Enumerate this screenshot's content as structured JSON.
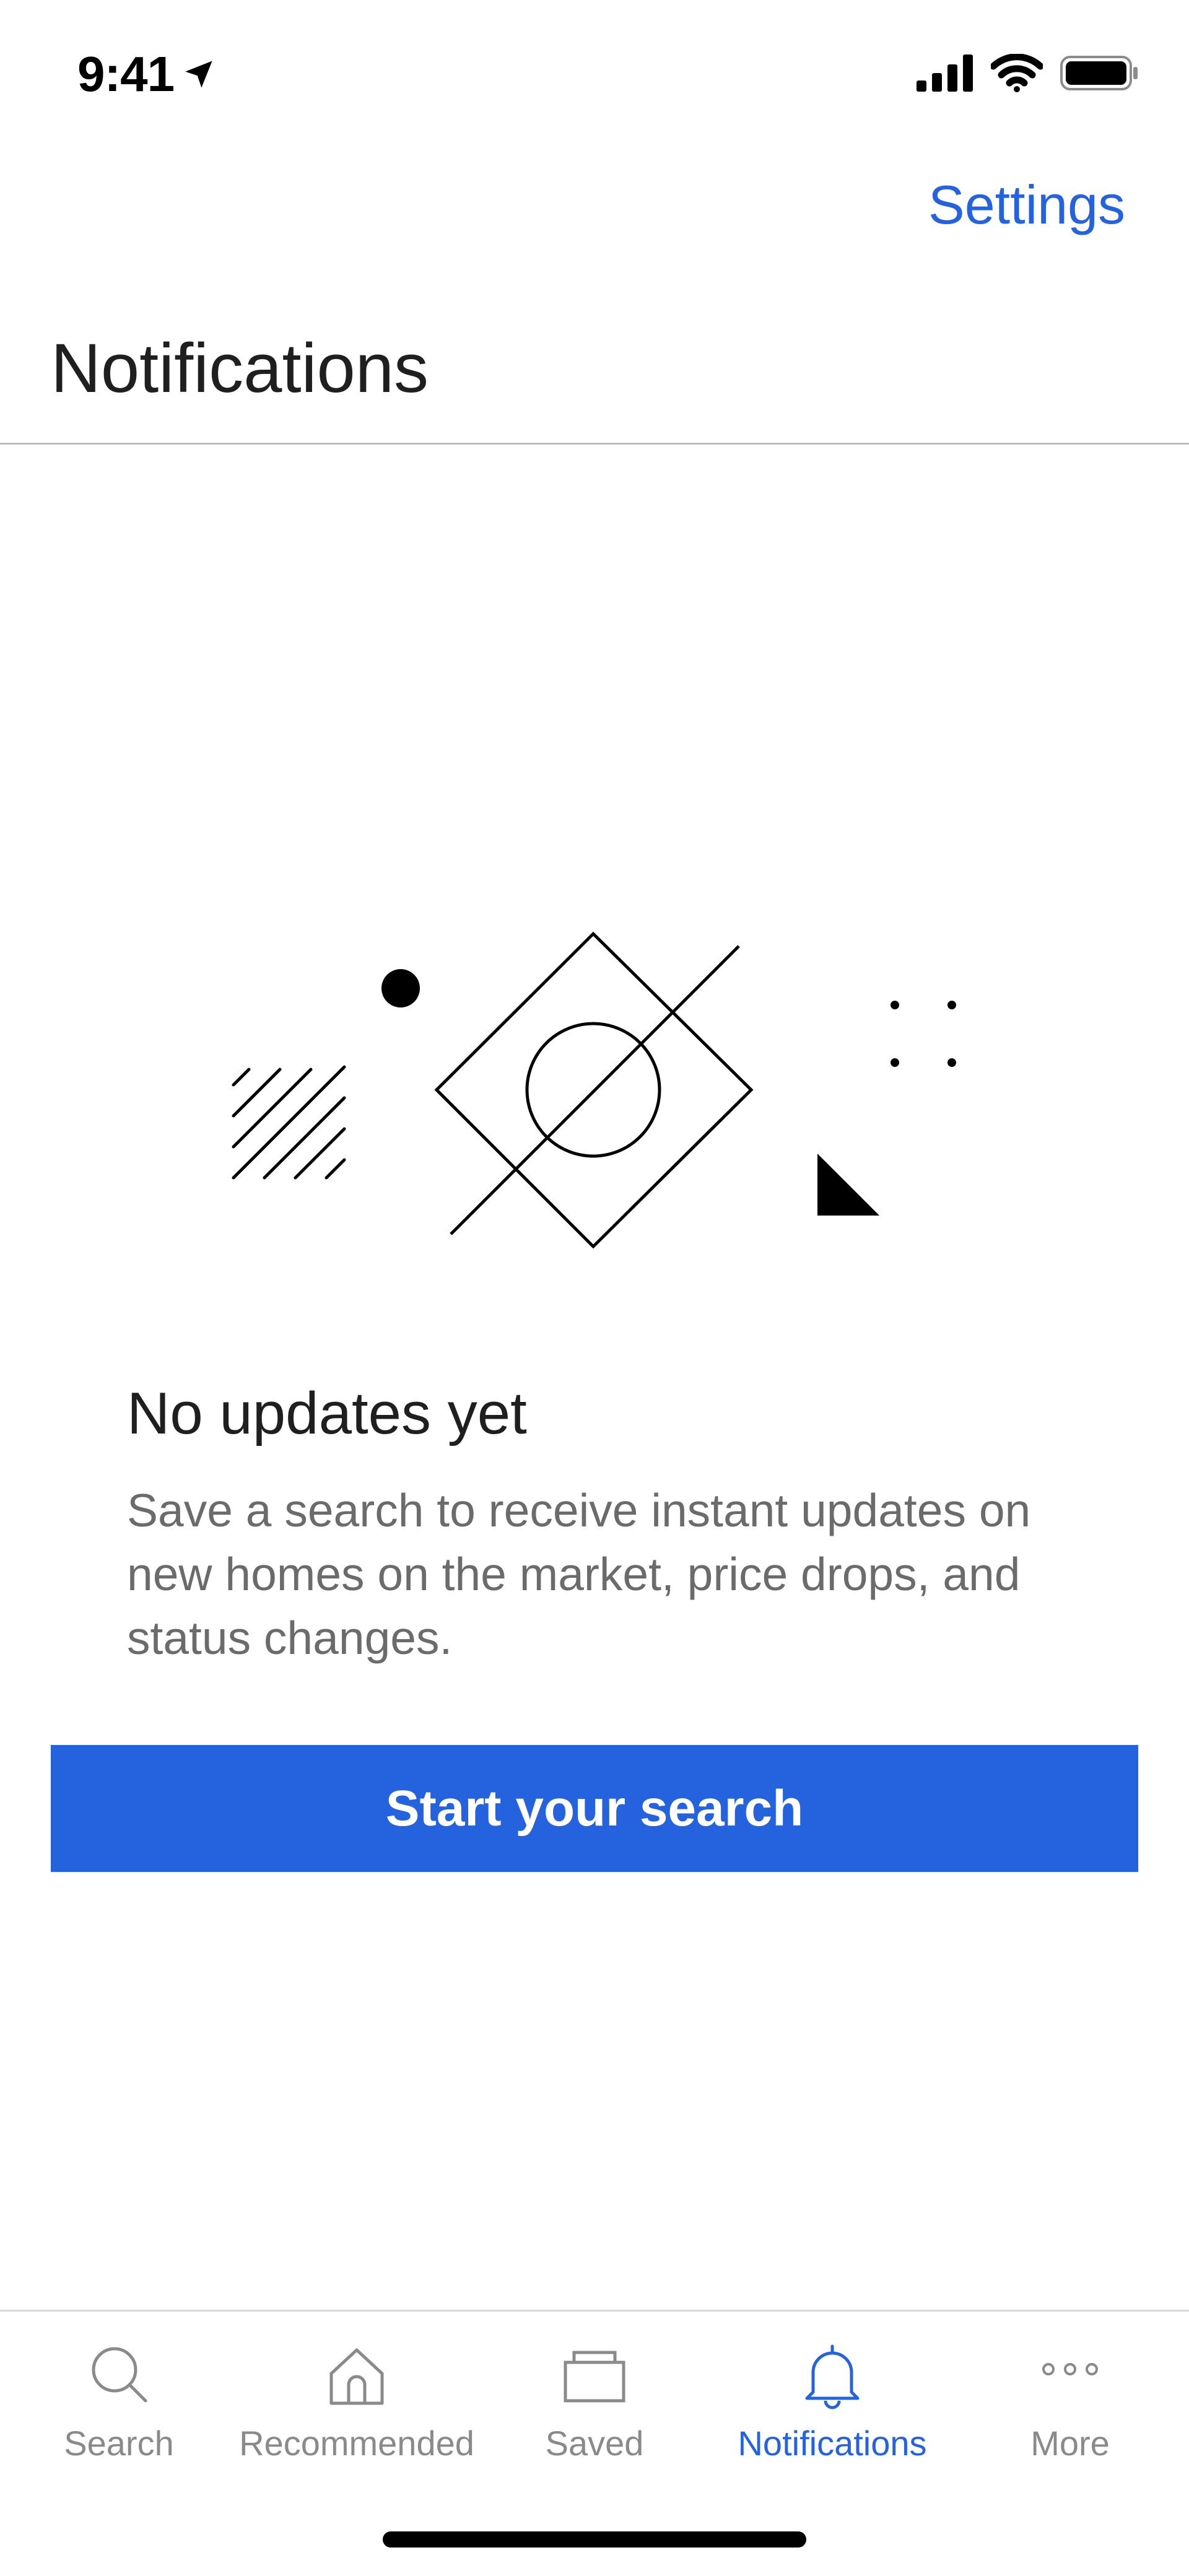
{
  "status_bar": {
    "time": "9:41"
  },
  "header": {
    "settings_label": "Settings",
    "title": "Notifications"
  },
  "empty_state": {
    "title": "No updates yet",
    "description": "Save a search to receive instant updates on new homes on the market, price drops, and status changes.",
    "cta_label": "Start your search"
  },
  "tabs": [
    {
      "label": "Search",
      "icon": "search-icon",
      "active": false
    },
    {
      "label": "Recommended",
      "icon": "home-icon",
      "active": false
    },
    {
      "label": "Saved",
      "icon": "saved-icon",
      "active": false
    },
    {
      "label": "Notifications",
      "icon": "bell-icon",
      "active": true
    },
    {
      "label": "More",
      "icon": "more-icon",
      "active": false
    }
  ],
  "colors": {
    "accent": "#2563de",
    "inactive_tab": "#8a8a8a",
    "title_text": "#1f1f1f",
    "body_text": "#6b6b6b"
  }
}
